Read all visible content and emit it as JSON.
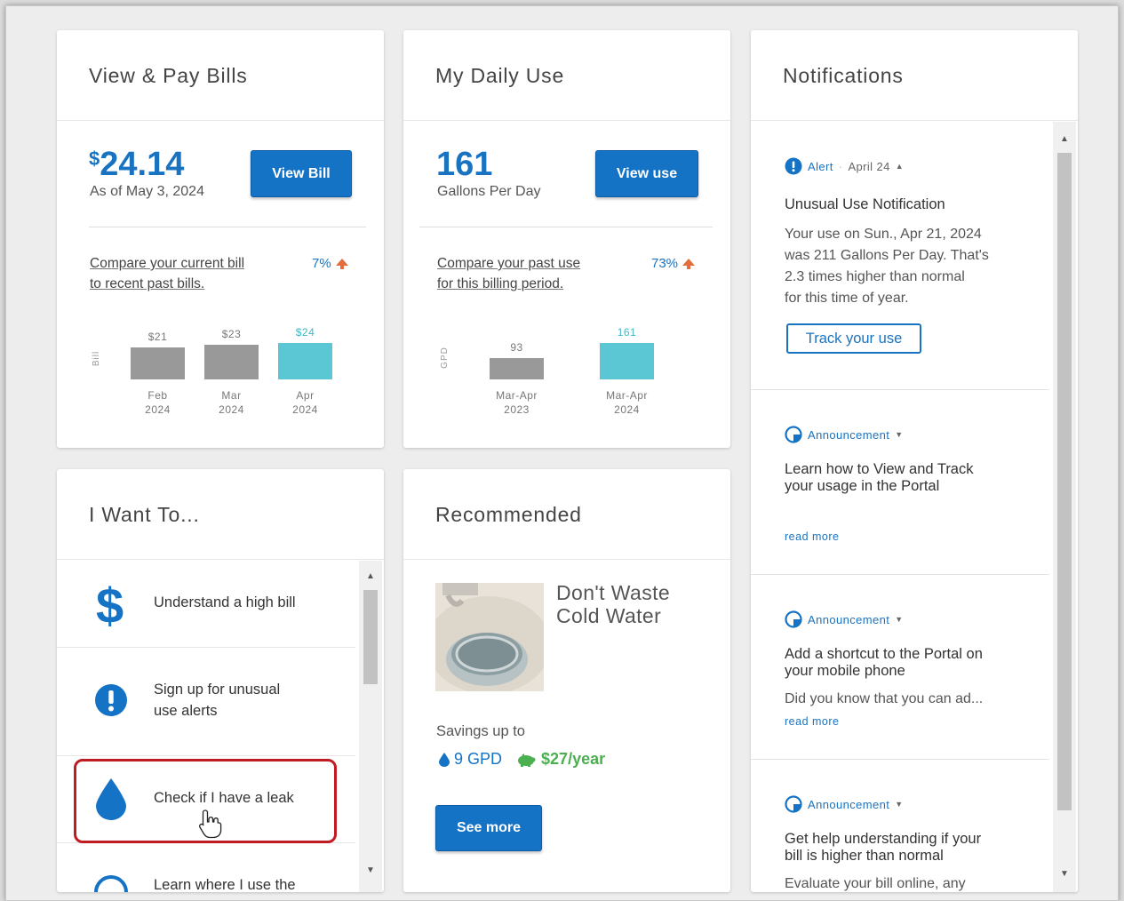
{
  "view_pay_bills": {
    "title": "View & Pay Bills",
    "amount_symbol": "$",
    "amount": "24.14",
    "as_of": "As of May 3, 2024",
    "button": "View Bill",
    "compare_line1": "Compare your current bill",
    "compare_line2": "to recent past bills.",
    "change_pct": "7%",
    "axis_label": "Bill",
    "chart_data": {
      "type": "bar",
      "categories": [
        "Feb 2024",
        "Mar 2024",
        "Apr 2024"
      ],
      "values": [
        21,
        23,
        24
      ],
      "value_labels": [
        "$21",
        "$23",
        "$24"
      ],
      "category_line1": [
        "Feb",
        "Mar",
        "Apr"
      ],
      "category_line2": [
        "2024",
        "2024",
        "2024"
      ],
      "colors": [
        "#999999",
        "#999999",
        "#5bc6d4"
      ]
    }
  },
  "daily_use": {
    "title": "My Daily Use",
    "value": "161",
    "unit": "Gallons Per Day",
    "button": "View use",
    "compare_line1": "Compare your past use",
    "compare_line2": "for this billing period.",
    "change_pct": "73%",
    "axis_label": "GPD",
    "chart_data": {
      "type": "bar",
      "categories": [
        "Mar-Apr 2023",
        "Mar-Apr 2024"
      ],
      "values": [
        93,
        161
      ],
      "value_labels": [
        "93",
        "161"
      ],
      "category_line1": [
        "Mar-Apr",
        "Mar-Apr"
      ],
      "category_line2": [
        "2023",
        "2024"
      ],
      "colors": [
        "#999999",
        "#5bc6d4"
      ]
    }
  },
  "notifications": {
    "title": "Notifications",
    "items": [
      {
        "type": "Alert",
        "date": "April 24",
        "title": "Unusual Use Notification",
        "body_lines": [
          "Your use on Sun., Apr 21, 2024",
          "was 211 Gallons Per Day. That's",
          "2.3 times higher than normal",
          "for this time of year."
        ],
        "button": "Track your use"
      },
      {
        "type": "Announcement",
        "title_lines": [
          "Learn how to View and Track",
          "your usage in the Portal"
        ],
        "read_more": "read more"
      },
      {
        "type": "Announcement",
        "title_lines": [
          "Add a shortcut to the Portal on",
          "your mobile phone"
        ],
        "body": "Did you know that you can ad...",
        "read_more": "read more"
      },
      {
        "type": "Announcement",
        "title_lines": [
          "Get help understanding if your",
          "bill is higher than normal"
        ],
        "body": "Evaluate your bill online, any"
      }
    ]
  },
  "i_want_to": {
    "title": "I Want To...",
    "items": [
      {
        "icon": "dollar-icon",
        "label_lines": [
          "Understand a high bill"
        ]
      },
      {
        "icon": "alert-icon",
        "label_lines": [
          "Sign up for unusual",
          "use alerts"
        ]
      },
      {
        "icon": "water-drop-icon",
        "label_lines": [
          "Check if I have a leak"
        ]
      },
      {
        "icon": "info-icon",
        "label_lines": [
          "Learn where I use the"
        ]
      }
    ]
  },
  "recommended": {
    "title": "Recommended",
    "tip_line1": "Don't Waste",
    "tip_line2": "Cold Water",
    "savings_label": "Savings up to",
    "savings_gpd": "9 GPD",
    "savings_money": "$27/year",
    "button": "See more"
  },
  "colors": {
    "accent": "#1473c5",
    "highlight_bar": "#5bc6d4",
    "past_bar": "#999999",
    "increase_arrow": "#e36d3c",
    "savings_green": "#4caf50",
    "annotation_red": "#c01b22"
  }
}
